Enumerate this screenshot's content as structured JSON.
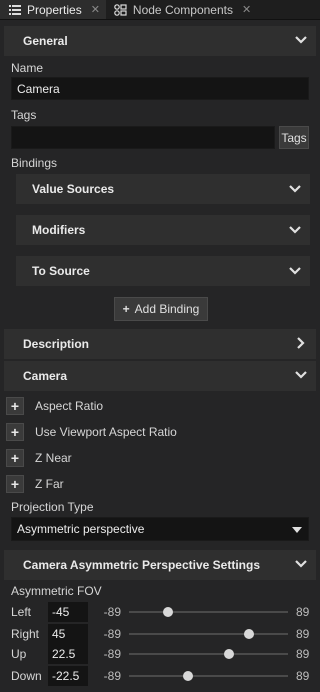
{
  "tabs": [
    {
      "label": "Properties",
      "icon": "list-icon",
      "active": true
    },
    {
      "label": "Node Components",
      "icon": "components-icon",
      "active": false
    }
  ],
  "general": {
    "title": "General",
    "name_label": "Name",
    "name_value": "Camera",
    "tags_label": "Tags",
    "tags_value": "",
    "tags_button": "Tags",
    "bindings_label": "Bindings",
    "value_sources": "Value Sources",
    "modifiers": "Modifiers",
    "to_source": "To Source",
    "add_binding": "Add Binding"
  },
  "description": {
    "title": "Description"
  },
  "camera": {
    "title": "Camera",
    "properties": [
      "Aspect Ratio",
      "Use Viewport Aspect Ratio",
      "Z Near",
      "Z Far"
    ],
    "projection_label": "Projection Type",
    "projection_value": "Asymmetric perspective"
  },
  "asym": {
    "title": "Camera Asymmetric Perspective Settings",
    "fov_label": "Asymmetric FOV",
    "rows": [
      {
        "name": "Left",
        "value": "-45",
        "min": "-89",
        "max": "89",
        "fraction": 0.247
      },
      {
        "name": "Right",
        "value": "45",
        "min": "-89",
        "max": "89",
        "fraction": 0.753
      },
      {
        "name": "Up",
        "value": "22.5",
        "min": "-89",
        "max": "89",
        "fraction": 0.626
      },
      {
        "name": "Down",
        "value": "-22.5",
        "min": "-89",
        "max": "89",
        "fraction": 0.374
      }
    ]
  }
}
